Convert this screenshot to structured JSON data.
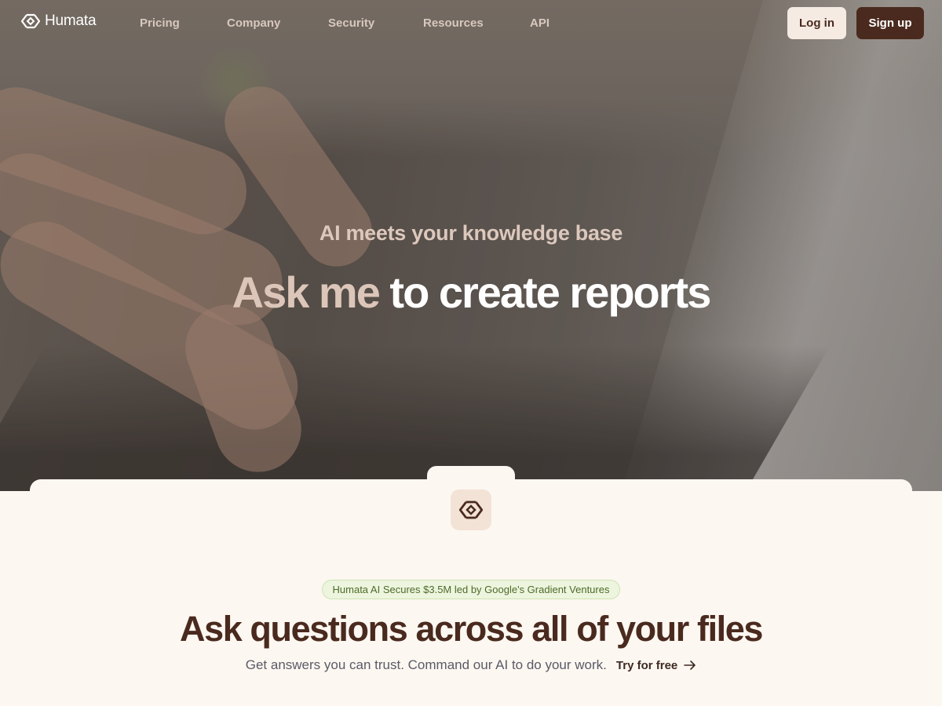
{
  "brand": {
    "name": "Humata",
    "logo_icon": "humata-logo-icon",
    "accent": "#4a2a1e"
  },
  "nav": {
    "links": [
      "Pricing",
      "Company",
      "Security",
      "Resources",
      "API"
    ],
    "login_label": "Log in",
    "signup_label": "Sign up"
  },
  "hero": {
    "subtitle": "AI meets your knowledge base",
    "title_dim": "Ask me",
    "title_bright": "to create reports"
  },
  "feature": {
    "badge": "Humata AI Secures $3.5M led by Google's Gradient Ventures",
    "title": "Ask questions across all of your files",
    "subtitle": "Get answers you can trust. Command our AI to do your work.",
    "cta_label": "Try for free",
    "cta_icon": "arrow-right-icon"
  }
}
